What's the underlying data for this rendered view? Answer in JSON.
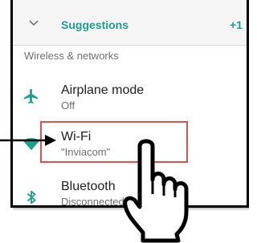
{
  "suggestions": {
    "label": "Suggestions",
    "count": "+1",
    "icon": "chevron-down-icon"
  },
  "section_header": "Wireless & networks",
  "settings": [
    {
      "title": "Airplane mode",
      "subtitle": "Off",
      "icon": "airplane-icon"
    },
    {
      "title": "Wi-Fi",
      "subtitle": "\"Inviacom\"",
      "icon": "wifi-icon"
    },
    {
      "title": "Bluetooth",
      "subtitle": "Disconnected",
      "icon": "bluetooth-icon"
    }
  ],
  "colors": {
    "accent": "#1e9e8c",
    "highlight": "#e05050",
    "pointer": "#000000"
  }
}
